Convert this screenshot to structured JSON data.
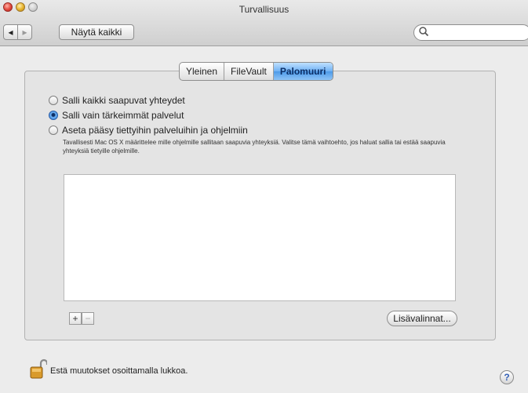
{
  "window": {
    "title": "Turvallisuus"
  },
  "toolbar": {
    "back_icon": "◂",
    "forward_icon": "▸",
    "show_all_label": "Näytä kaikki",
    "search_value": "",
    "search_placeholder": ""
  },
  "tabs": [
    {
      "label": "Yleinen",
      "selected": false
    },
    {
      "label": "FileVault",
      "selected": false
    },
    {
      "label": "Palomuuri",
      "selected": true
    }
  ],
  "firewall": {
    "options": [
      {
        "label": "Salli kaikki saapuvat yhteydet",
        "checked": false
      },
      {
        "label": "Salli vain tärkeimmät palvelut",
        "checked": true
      },
      {
        "label": "Aseta pääsy tiettyihin palveluihin ja ohjelmiin",
        "checked": false
      }
    ],
    "description": "Tavallisesti Mac OS X määrittelee mille ohjelmille sallitaan saapuvia yhteyksiä. Valitse tämä vaihtoehto, jos haluat sallia tai estää saapuvia yhteyksiä tietyille ohjelmille.",
    "add_label": "+",
    "remove_label": "−",
    "advanced_label": "Lisävalinnat..."
  },
  "footer": {
    "lock_text": "Estä muutokset osoittamalla lukkoa.",
    "help_label": "?"
  },
  "colors": {
    "tab_selected": "#6fb1f3",
    "window_bg": "#ececec"
  }
}
